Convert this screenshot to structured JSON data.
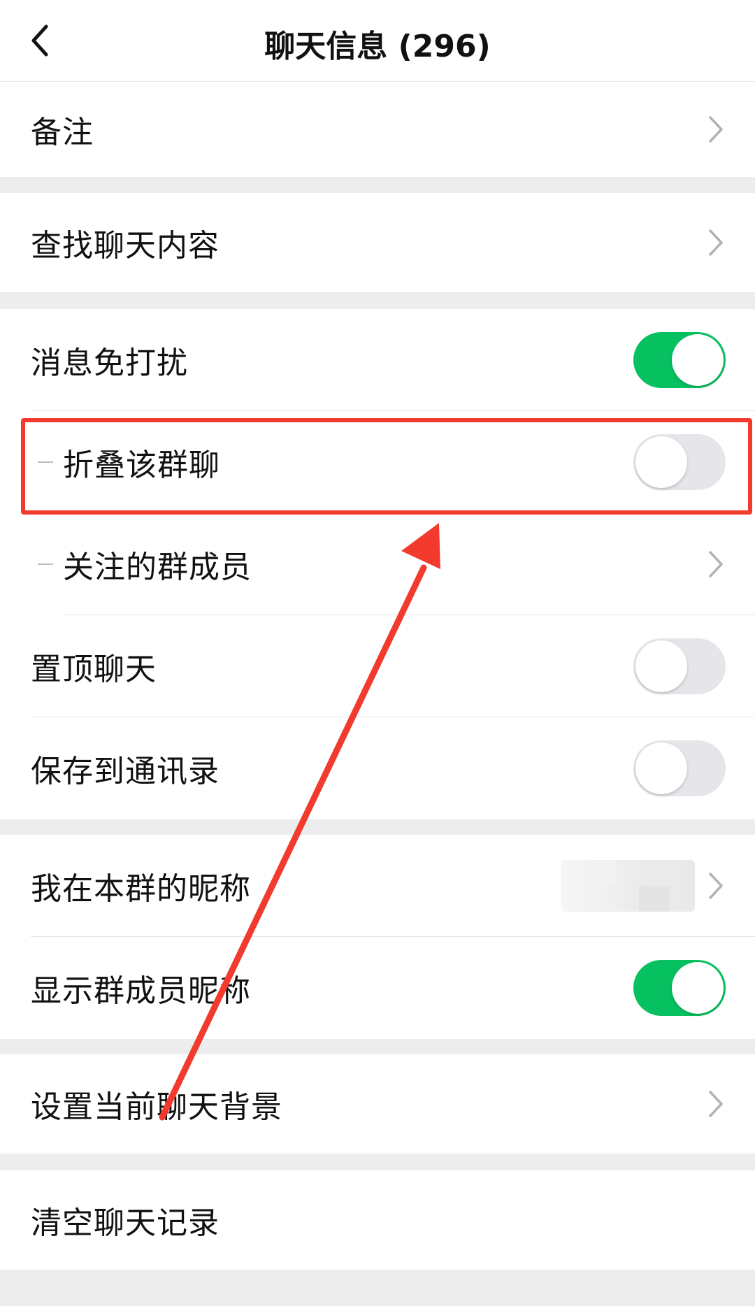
{
  "header": {
    "title": "聊天信息 (296)",
    "back_icon": "chevron-left-icon"
  },
  "sections": {
    "remark": {
      "label": "备注"
    },
    "search": {
      "label": "查找聊天内容"
    },
    "settings": {
      "mute": {
        "label": "消息免打扰",
        "enabled": true
      },
      "fold": {
        "label": "折叠该群聊",
        "enabled": false
      },
      "followed": {
        "label": "关注的群成员"
      },
      "pin": {
        "label": "置顶聊天",
        "enabled": false
      },
      "save_contacts": {
        "label": "保存到通讯录",
        "enabled": false
      }
    },
    "nickname": {
      "my_nickname": {
        "label": "我在本群的昵称"
      },
      "show_nicknames": {
        "label": "显示群成员昵称",
        "enabled": true
      }
    },
    "background": {
      "label": "设置当前聊天背景"
    },
    "clear": {
      "label": "清空聊天记录"
    }
  },
  "colors": {
    "toggle_on": "#07c160",
    "toggle_off": "#e5e5ea",
    "annotation": "#f23a2f"
  }
}
